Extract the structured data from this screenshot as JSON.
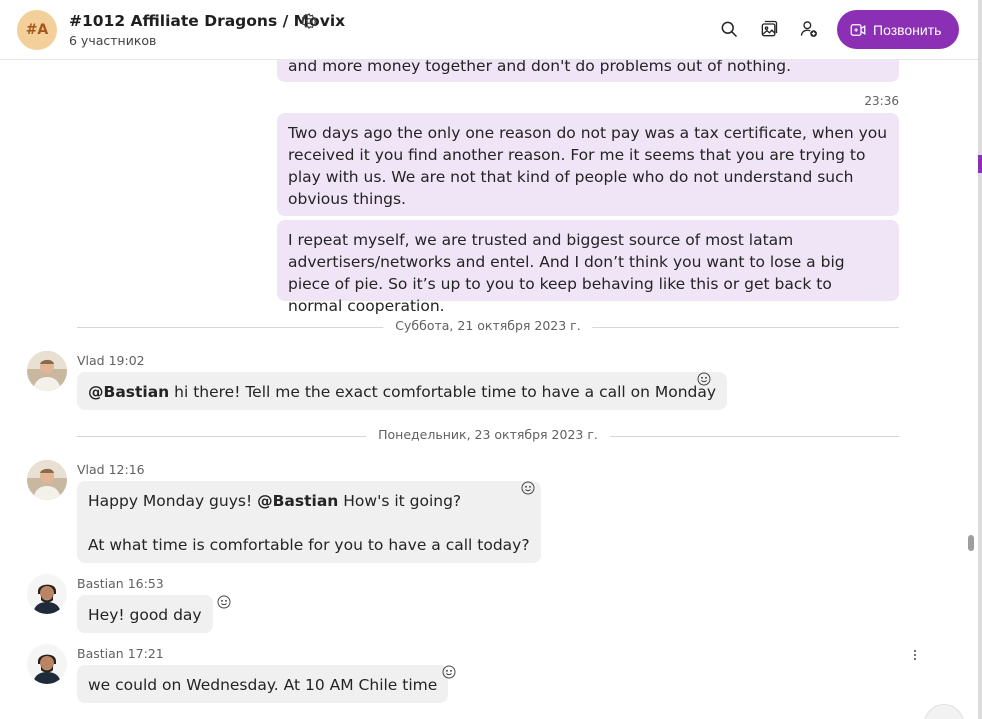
{
  "header": {
    "avatar_initials": "#A",
    "title": "#1012 Affiliate Dragons / Movix",
    "subtitle": "6 участников",
    "call_label": "Позвонить",
    "icons": [
      "search-icon",
      "gallery-icon",
      "add-people-icon",
      "settings-icon",
      "video-call-icon"
    ],
    "accent_color": "#8b2fb4"
  },
  "messages": {
    "m0_text": "and more money together and don't do problems out of nothing.",
    "m1_time": "23:36",
    "m1_text": "Two days ago the only one reason do not pay was a tax certificate, when you received it you find another reason. For me it seems that you are trying to play with us. We are not that kind of people who do not understand such obvious things.",
    "m2_text": "I repeat myself, we are trusted and biggest source of most latam advertisers/networks and entel. And I don’t think you want to lose a big piece of pie. So it’s up to you to keep behaving like this or get back to normal cooperation.",
    "divider1": "Суббота, 21 октября 2023 г.",
    "m3_sender": "Vlad",
    "m3_time": "19:02",
    "m3_mention": "@Bastian",
    "m3_text": " hi there! Tell me the exact comfortable time to have a call on Monday",
    "divider2": "Понедельник, 23 октября 2023 г.",
    "m4_sender": "Vlad",
    "m4_time": "12:16",
    "m4_text_a": "Happy Monday guys! ",
    "m4_mention": "@Bastian",
    "m4_text_b": " How's it going?",
    "m4_text_c": "At what time is comfortable for you to have a call today?",
    "m5_sender": "Bastian",
    "m5_time": "16:53",
    "m5_text": "Hey! good day",
    "m6_sender": "Bastian",
    "m6_time": "17:21",
    "m6_text": "we could on Wednesday. At 10 AM Chile time"
  },
  "colors": {
    "outgoing_bubble": "#f0e4f7",
    "incoming_bubble": "#f0f0f0"
  }
}
